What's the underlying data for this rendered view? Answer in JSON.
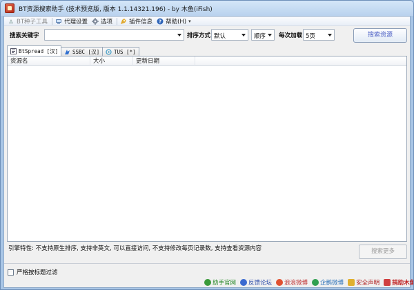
{
  "window": {
    "title": "BT资源搜索助手 (技术预览版, 版本 1.1.14321.196) - by 木鱼(iFish)"
  },
  "menu": [
    {
      "label": "BT种子工具",
      "icon": "seed-icon",
      "disabled": true
    },
    {
      "label": "代理设置",
      "icon": "proxy-icon"
    },
    {
      "label": "选项",
      "icon": "gear-icon"
    },
    {
      "label": "插件信息",
      "icon": "plugin-icon"
    },
    {
      "label": "帮助(H)",
      "icon": "help-icon",
      "dropdown": true
    }
  ],
  "search": {
    "keyword_label": "搜索关键字",
    "keyword_value": "",
    "sort_label": "排序方式",
    "sort_value": "默认",
    "order_value": "顺序",
    "load_label": "每次加载",
    "load_value": "5页",
    "search_button": "搜索资源"
  },
  "tabs": [
    {
      "label": "BtSpread [汉]",
      "icon": "btspread-icon",
      "active": true
    },
    {
      "label": "SSBC [汉]",
      "icon": "ssbc-icon",
      "active": false
    },
    {
      "label": "TUS [*]",
      "icon": "tus-icon",
      "active": false
    }
  ],
  "list": {
    "columns": [
      "资源名",
      "大小",
      "更新日期"
    ],
    "rows": []
  },
  "engine_info": "引擎特性: 不支持原生排序, 支持非英文, 可以直接访问, 不支持修改每页记录数, 支持查看资源内容",
  "more_button": "搜索更多",
  "filter": {
    "label": "严格按标题过滤",
    "checked": false
  },
  "footer_links": [
    {
      "label": "助手官网",
      "color": "#2a8a2a",
      "icon_color": "#3a9a3a"
    },
    {
      "label": "反馈论坛",
      "color": "#2a4aa8",
      "icon_color": "#3a6ad0"
    },
    {
      "label": "浪浪微博",
      "color": "#c03030",
      "icon_color": "#e05030"
    },
    {
      "label": "企鹅微博",
      "color": "#2a70b8",
      "icon_color": "#30a050"
    },
    {
      "label": "安全声明",
      "color": "#b02020",
      "icon_color": "#e0b030"
    },
    {
      "label": "捐助木鱼",
      "color": "#c02020",
      "icon_color": "#d04040"
    }
  ]
}
